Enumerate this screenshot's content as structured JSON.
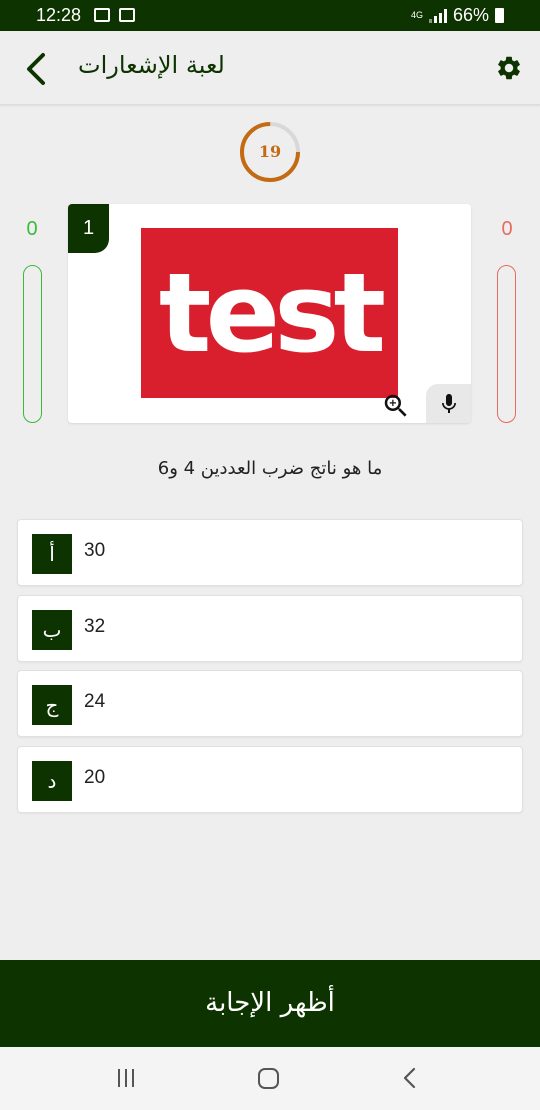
{
  "status_bar": {
    "time": "12:28",
    "network": "4G",
    "battery": "66%"
  },
  "header": {
    "title": "لعبة الإشعارات",
    "back_icon": "chevron-left-icon",
    "settings_icon": "gear-icon"
  },
  "timer": {
    "value": "19",
    "progress": 0.25,
    "color": "#c46a12"
  },
  "scores": {
    "left": "0",
    "right": "0",
    "left_color": "#3cba3c",
    "right_color": "#e86b62"
  },
  "question_card": {
    "number": "1",
    "image_text": "test",
    "image_color": "#d91f2e",
    "zoom_icon": "zoom-in-icon",
    "mic_icon": "microphone-icon"
  },
  "question": {
    "text": "ما هو ناتج ضرب العددين 4 و6"
  },
  "answers": [
    {
      "letter": "أ",
      "value": "30"
    },
    {
      "letter": "ب",
      "value": "32"
    },
    {
      "letter": "ج",
      "value": "24"
    },
    {
      "letter": "د",
      "value": "20"
    }
  ],
  "show_answer_label": "أظهر الإجابة",
  "colors": {
    "primary": "#0d3300",
    "background": "#eeeeee"
  }
}
